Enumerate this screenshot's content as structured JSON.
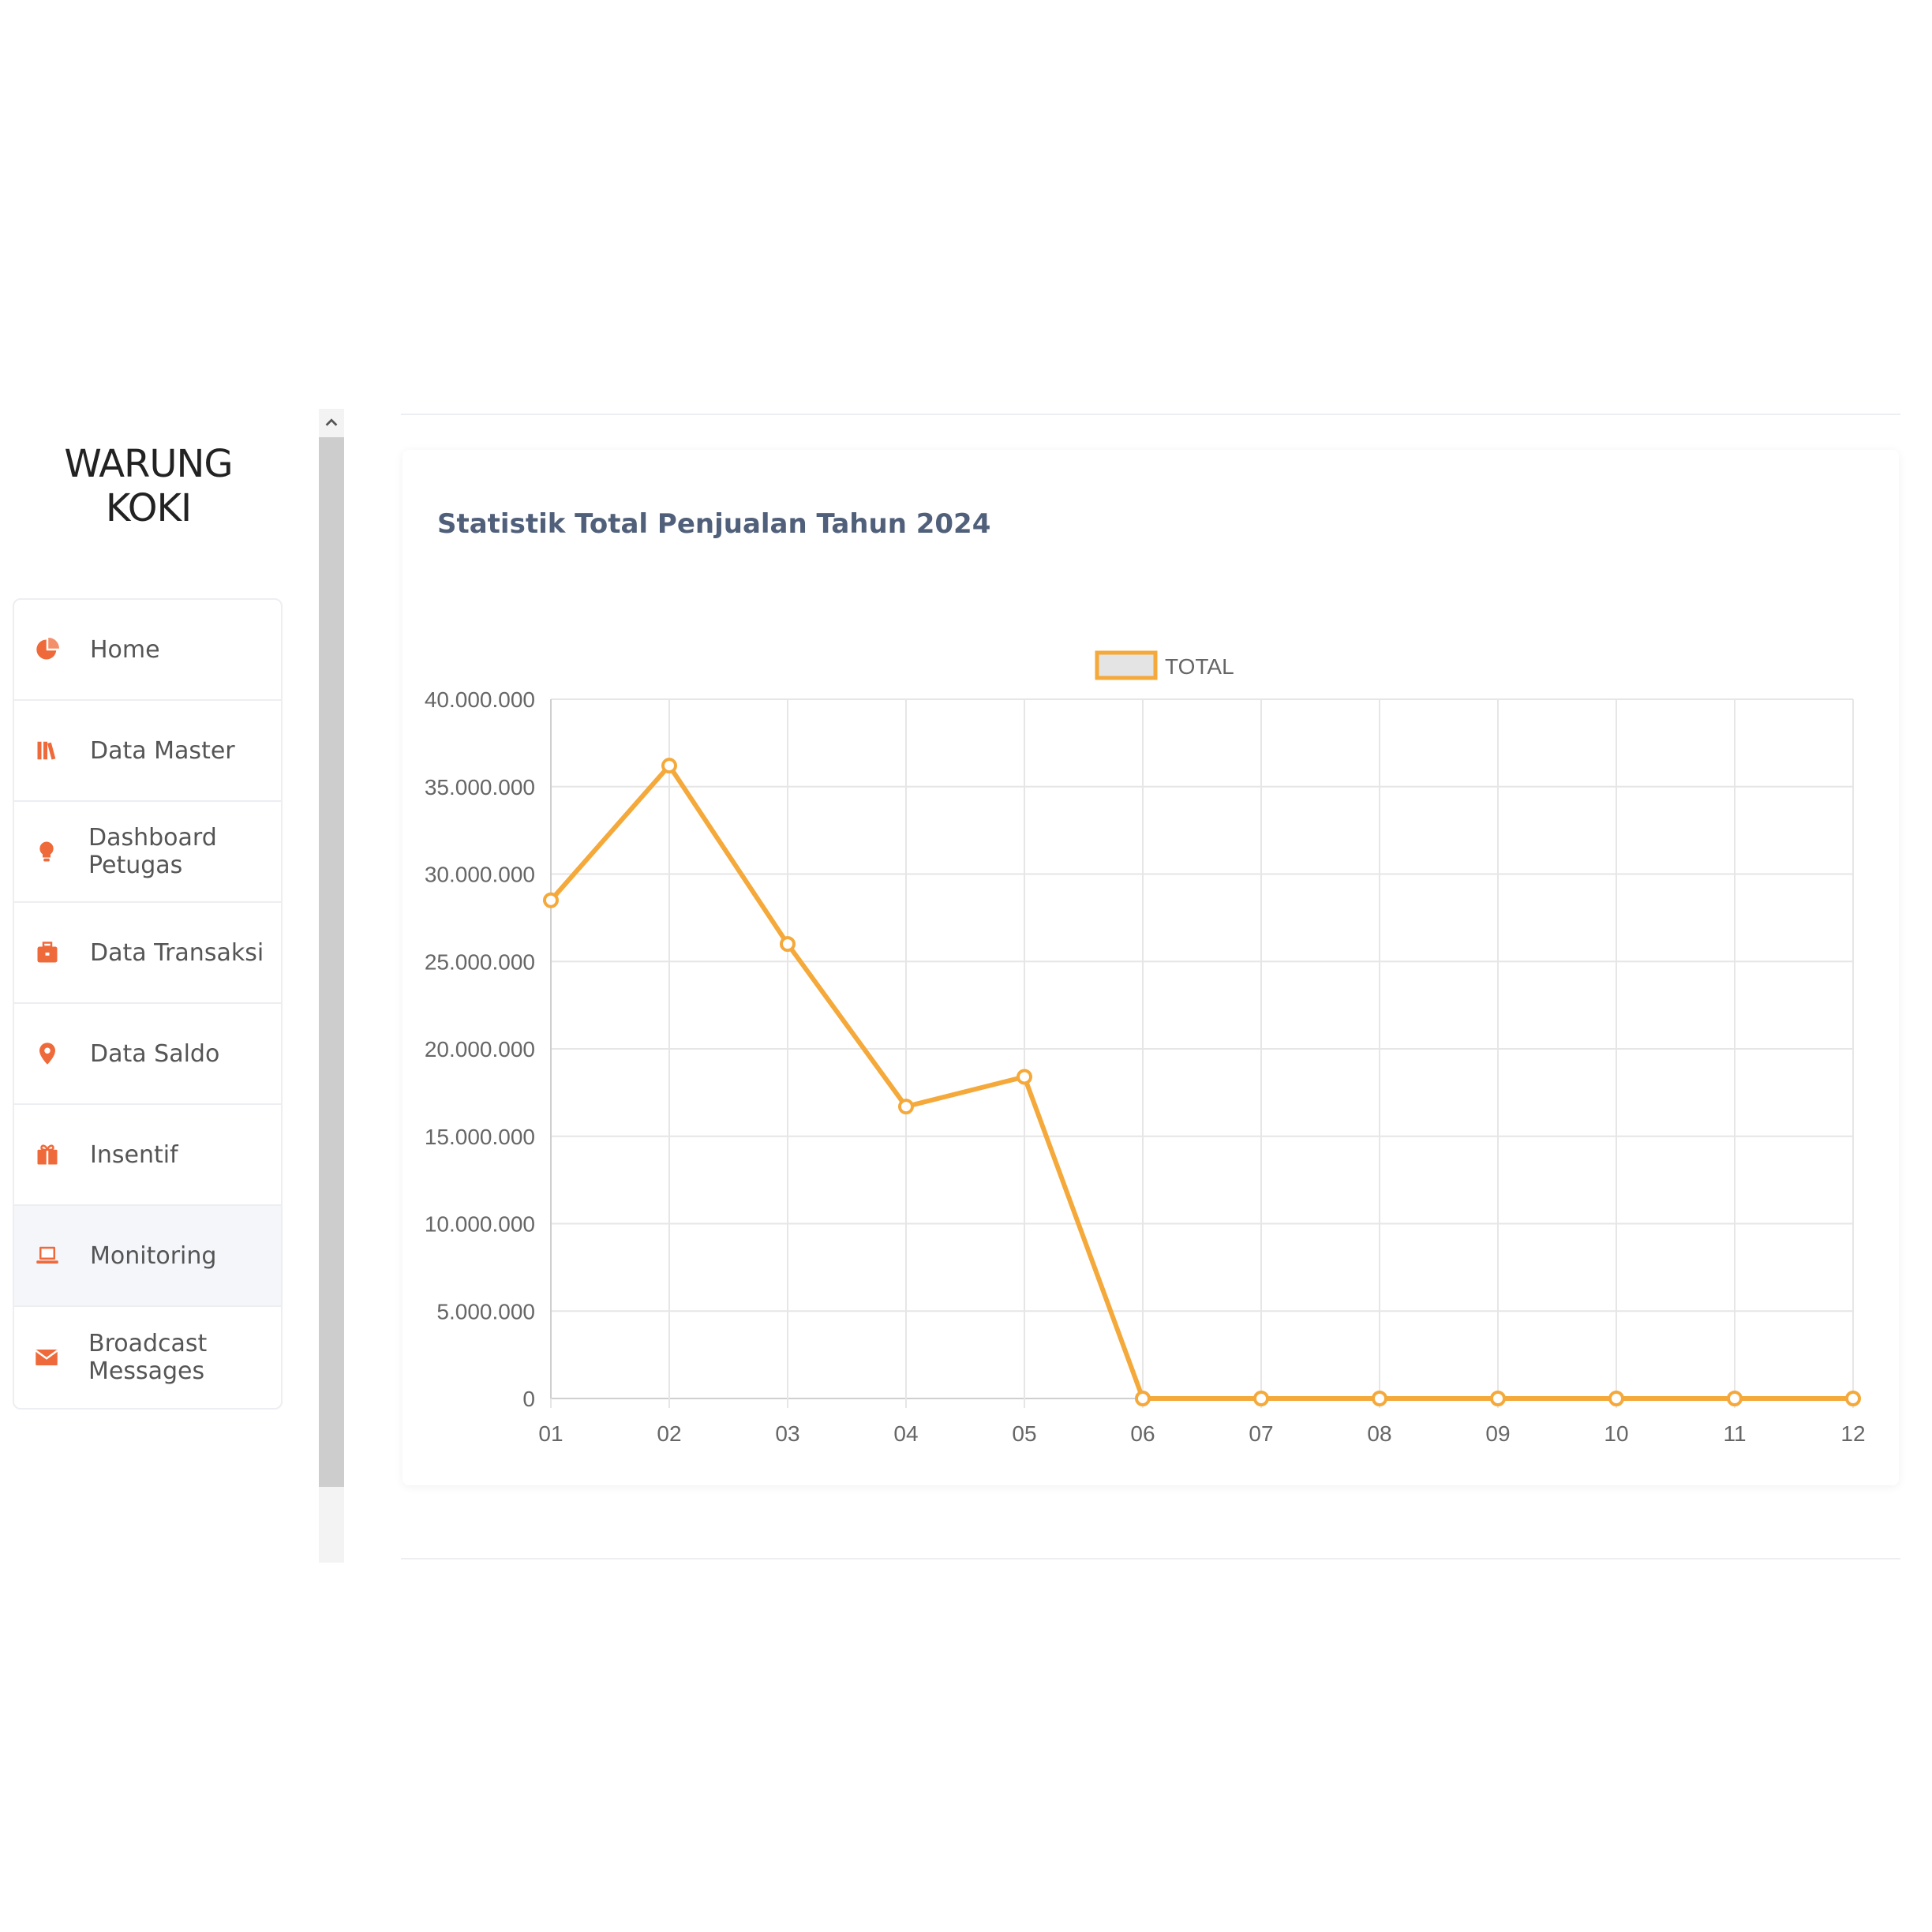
{
  "brand": {
    "name": "WARUNG KOKI"
  },
  "nav": {
    "items": [
      {
        "label": "Home",
        "icon": "pie-chart-icon",
        "active": false
      },
      {
        "label": "Data Master",
        "icon": "books-icon",
        "active": false
      },
      {
        "label": "Dashboard Petugas",
        "icon": "lightbulb-icon",
        "active": false
      },
      {
        "label": "Data Transaksi",
        "icon": "briefcase-icon",
        "active": false
      },
      {
        "label": "Data Saldo",
        "icon": "map-pin-icon",
        "active": false
      },
      {
        "label": "Insentif",
        "icon": "gift-icon",
        "active": false
      },
      {
        "label": "Monitoring",
        "icon": "laptop-icon",
        "active": true
      },
      {
        "label": "Broadcast Messages",
        "icon": "envelope-icon",
        "active": false
      }
    ]
  },
  "colors": {
    "accent": "#ef6a3a",
    "line": "#f4a93a",
    "legend_fill": "#e4e4e4",
    "grid": "#e6e6e6",
    "tick": "#666666"
  },
  "card": {
    "title": "Statistik Total Penjualan Tahun 2024"
  },
  "chart_data": {
    "type": "line",
    "title": "",
    "xlabel": "",
    "ylabel": "",
    "categories": [
      "01",
      "02",
      "03",
      "04",
      "05",
      "06",
      "07",
      "08",
      "09",
      "10",
      "11",
      "12"
    ],
    "series": [
      {
        "name": "TOTAL",
        "values": [
          28500000,
          36200000,
          26000000,
          16700000,
          18400000,
          0,
          0,
          0,
          0,
          0,
          0,
          0
        ]
      }
    ],
    "ylim": [
      0,
      40000000
    ],
    "yticks": [
      "0",
      "5.000.000",
      "10.000.000",
      "15.000.000",
      "20.000.000",
      "25.000.000",
      "30.000.000",
      "35.000.000",
      "40.000.000"
    ],
    "grid": true,
    "legend": "top-center"
  }
}
